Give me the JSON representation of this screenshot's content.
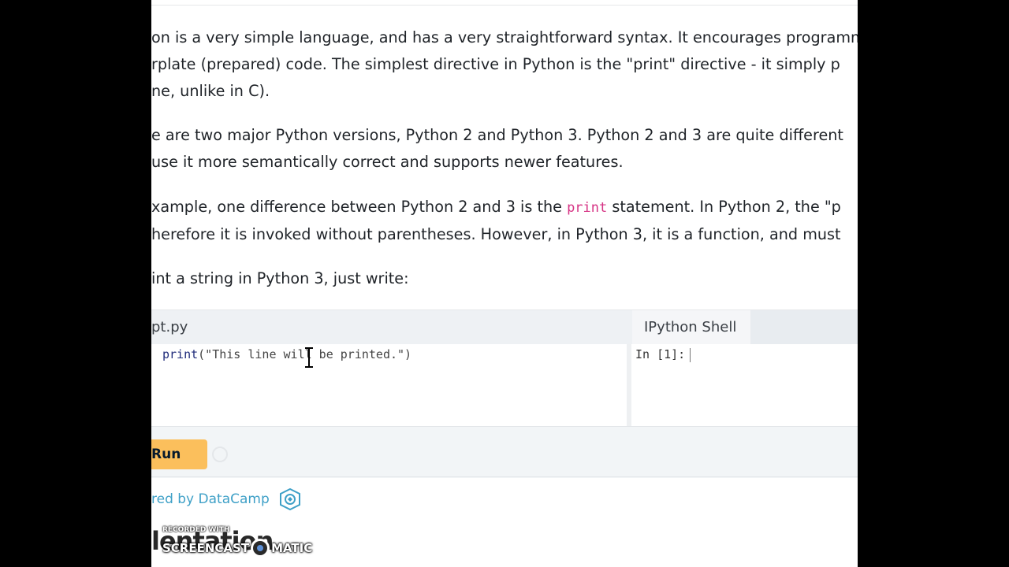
{
  "paragraphs": {
    "p1": [
      "on is a very simple language, and has a very straightforward syntax. It encourages programm",
      "rplate (prepared) code. The simplest directive in Python is the \"print\" directive - it simply p",
      "ne, unlike in C)."
    ],
    "p2": [
      "e are two major Python versions, Python 2 and Python 3. Python 2 and 3 are quite different",
      "use it more semantically correct and supports newer features."
    ],
    "p3_line1_before": "xample, one difference between Python 2 and 3 is the ",
    "p3_inline_code": "print",
    "p3_line1_after": " statement. In Python 2, the \"p",
    "p3_line2": "herefore it is invoked without parentheses. However, in Python 3, it is a function, and must",
    "p4": "int a string in Python 3, just write:"
  },
  "editor": {
    "script_tab": "pt.py",
    "shell_tab": "IPython Shell",
    "code_keyword": "print",
    "code_rest": "(\"This line will be printed.\")",
    "shell_prompt": "In [1]:",
    "run_label": "Run"
  },
  "footer": {
    "powered_by": "red by DataCamp",
    "datacamp_icon": "datacamp-logo-icon"
  },
  "watermark": {
    "recorded_with": "RECORDED WITH",
    "brand_left": "SCREENCAST",
    "brand_right": "MATIC",
    "behind_text": "lentation"
  },
  "colors": {
    "run_button": "#fbbf5c",
    "inline_code": "#d63384",
    "powered_link": "#3ea0c7"
  }
}
